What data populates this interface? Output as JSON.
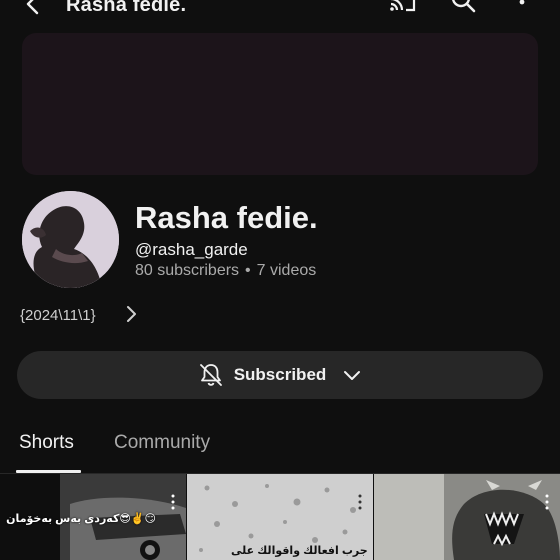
{
  "header": {
    "title": "Rasha fedie.",
    "icons": [
      "back-arrow-icon",
      "cast-icon",
      "search-icon",
      "more-vertical-icon"
    ]
  },
  "channel": {
    "name": "Rasha fedie.",
    "handle": "@rasha_garde",
    "subscribers": "80 subscribers",
    "separator": "•",
    "videos": "7 videos",
    "description": "{2024\\11\\1}"
  },
  "subscribe_button": {
    "label": "Subscribed",
    "icons": [
      "bell-off-icon",
      "chevron-down-icon"
    ]
  },
  "tabs": [
    {
      "label": "Shorts",
      "active": true
    },
    {
      "label": "Community",
      "active": false
    }
  ],
  "shorts": [
    {
      "caption": "کەردی بەس بەخۆمان😎✌️😏"
    },
    {
      "caption": "جرب  افعالك واقوالك على"
    },
    {
      "caption": ""
    }
  ],
  "colors": {
    "background": "#0f0f0f",
    "banner": "#1c141a",
    "button": "#272727",
    "secondary_text": "#aaaaaa"
  }
}
